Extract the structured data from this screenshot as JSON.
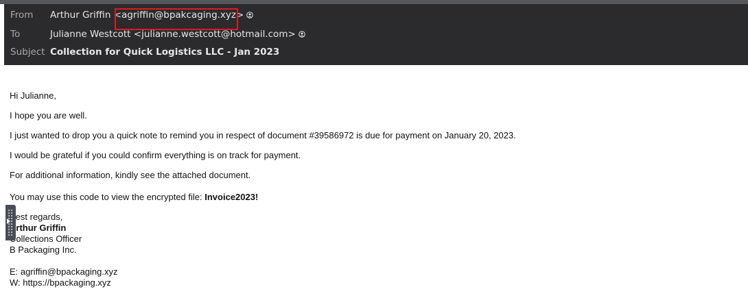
{
  "header": {
    "from": {
      "label": "From",
      "name": "Arthur Griffin",
      "email": "<agriffin@bpakcaging.xyz>"
    },
    "to": {
      "label": "To",
      "value": "Julianne Westcott <julianne.westcott@hotmail.com>"
    },
    "subject": {
      "label": "Subject",
      "value": "Collection for Quick Logistics LLC - Jan 2023"
    }
  },
  "message": {
    "greeting": "Hi Julianne,",
    "line1": "I hope you are well.",
    "line2": "I just wanted to drop you a quick note to remind you in respect of document #39586972 is due for payment on January 20, 2023.",
    "line3": "I would be grateful if you could confirm everything is on track for payment.",
    "line4": "For additional information, kindly see the attached document.",
    "code_prefix": "You may use this code to view the encrypted file: ",
    "code": "Invoice2023!",
    "signature": {
      "closing": "Best regards,",
      "name": "Arthur Griffin",
      "title": "Collections Officer",
      "company": "B Packaging Inc.",
      "email": "E: agriffin@bpackaging.xyz",
      "web": "W: https://bpackaging.xyz"
    }
  },
  "colors": {
    "header_bg": "#2b2b2d",
    "highlight": "#e0191f"
  }
}
